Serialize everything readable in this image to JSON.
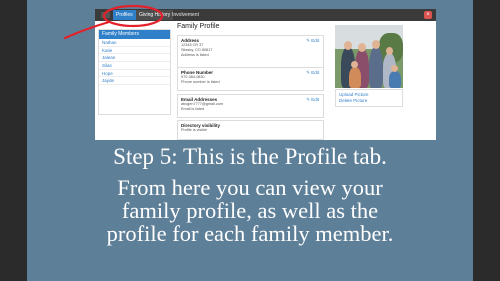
{
  "nav": {
    "tabs": [
      "Profiles",
      "Giving History",
      "Involvement"
    ],
    "close_icon": "close-icon"
  },
  "page": {
    "title": "Family Profile"
  },
  "sidebar": {
    "header": "Family Members",
    "items": [
      "Nathan",
      "Katie",
      "Jalean",
      "Silas",
      "Hope",
      "Jayde"
    ]
  },
  "cards": {
    "address": {
      "title": "Address",
      "edit": "Edit",
      "lines": [
        "12345 CR 37",
        "Silasby, CO 80817",
        "Address is listed"
      ]
    },
    "phone": {
      "title": "Phone Number",
      "edit": "Edit",
      "lines": [
        "970-384-0830",
        "Phone number is listed"
      ]
    },
    "email": {
      "title": "Email Addresses",
      "edit": "Edit",
      "lines": [
        "abcgen7777@gmail.com",
        "Email is listed"
      ]
    },
    "directory": {
      "title": "Directory visibility",
      "lines": [
        "Profile is visible"
      ]
    }
  },
  "photo": {
    "upload_label": "Upload Picture",
    "delete_label": "Delete Picture"
  },
  "colors": {
    "accent": "#2f7fc9",
    "slide_bg": "#5e7f98",
    "annotation": "#e3212b"
  },
  "caption": {
    "step": "Step 5: This is the Profile tab.",
    "lines": [
      "From here you can view your",
      "family profile, as well as the",
      "profile for each family member."
    ]
  }
}
